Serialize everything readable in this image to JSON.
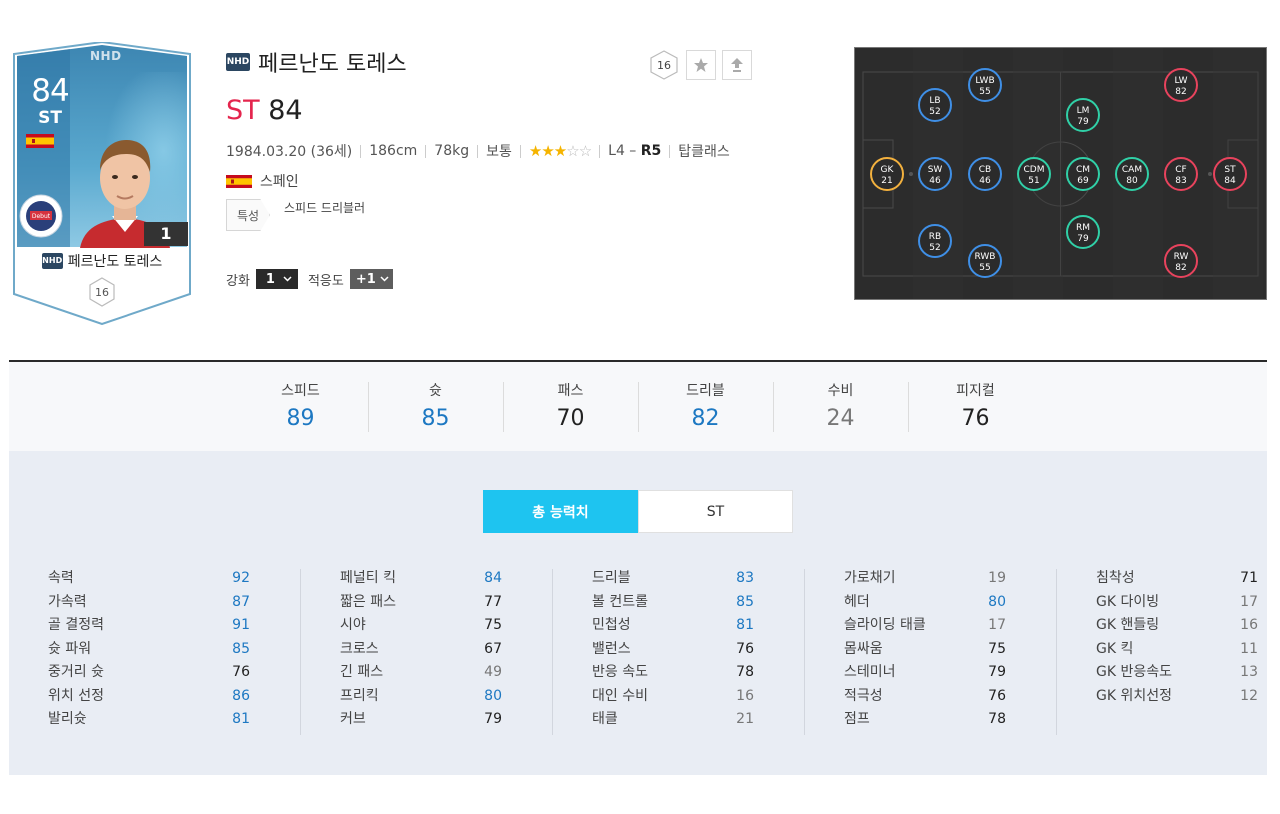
{
  "card": {
    "overall": "84",
    "position": "ST",
    "season": "NHD",
    "level": "1",
    "name": "페르난도 토레스",
    "hex_number": "16"
  },
  "player": {
    "season_badge": "NHD",
    "name": "페르난도 토레스",
    "position": "ST",
    "overall": "84",
    "birth": "1984.03.20 (36세)",
    "height": "186cm",
    "weight": "78kg",
    "body_type": "보통",
    "skill_stars": 3,
    "foot_left": "L4 –",
    "foot_right": "R5",
    "club_type": "탑클래스",
    "nation": "스페인",
    "trait_label": "특성",
    "trait": "스피드 드리블러",
    "enhance_label": "강화",
    "enhance_value": "1",
    "adapt_label": "적응도",
    "adapt_value": "+1"
  },
  "actions": {
    "hex_number": "16",
    "star_icon": "star-icon",
    "upgrade_icon": "upgrade-arrow-icon"
  },
  "pitch": {
    "positions": [
      {
        "pos": "GK",
        "val": "21",
        "kind": "gk"
      },
      {
        "pos": "SW",
        "val": "46",
        "kind": "def"
      },
      {
        "pos": "LB",
        "val": "52",
        "kind": "def"
      },
      {
        "pos": "RB",
        "val": "52",
        "kind": "def"
      },
      {
        "pos": "LWB",
        "val": "55",
        "kind": "def"
      },
      {
        "pos": "RWB",
        "val": "55",
        "kind": "def"
      },
      {
        "pos": "CB",
        "val": "46",
        "kind": "def"
      },
      {
        "pos": "CDM",
        "val": "51",
        "kind": "mid"
      },
      {
        "pos": "LM",
        "val": "79",
        "kind": "mid"
      },
      {
        "pos": "CM",
        "val": "69",
        "kind": "mid"
      },
      {
        "pos": "RM",
        "val": "79",
        "kind": "mid"
      },
      {
        "pos": "CAM",
        "val": "80",
        "kind": "mid"
      },
      {
        "pos": "LW",
        "val": "82",
        "kind": "fwd"
      },
      {
        "pos": "CF",
        "val": "83",
        "kind": "fwd"
      },
      {
        "pos": "RW",
        "val": "82",
        "kind": "fwd"
      },
      {
        "pos": "ST",
        "val": "84",
        "kind": "fwd"
      }
    ]
  },
  "summary": [
    {
      "label": "스피드",
      "value": "89",
      "tone": "blue"
    },
    {
      "label": "슛",
      "value": "85",
      "tone": "blue"
    },
    {
      "label": "패스",
      "value": "70",
      "tone": "dark"
    },
    {
      "label": "드리블",
      "value": "82",
      "tone": "blue"
    },
    {
      "label": "수비",
      "value": "24",
      "tone": "gray"
    },
    {
      "label": "피지컬",
      "value": "76",
      "tone": "dark"
    }
  ],
  "tabs": {
    "total": "총 능력치",
    "position": "ST"
  },
  "attributes": [
    [
      {
        "name": "속력",
        "value": "92",
        "tone": "blue"
      },
      {
        "name": "가속력",
        "value": "87",
        "tone": "blue"
      },
      {
        "name": "골 결정력",
        "value": "91",
        "tone": "blue"
      },
      {
        "name": "슛 파워",
        "value": "85",
        "tone": "blue"
      },
      {
        "name": "중거리 슛",
        "value": "76",
        "tone": "dark"
      },
      {
        "name": "위치 선정",
        "value": "86",
        "tone": "blue"
      },
      {
        "name": "발리슛",
        "value": "81",
        "tone": "blue"
      }
    ],
    [
      {
        "name": "페널티 킥",
        "value": "84",
        "tone": "blue"
      },
      {
        "name": "짧은 패스",
        "value": "77",
        "tone": "dark"
      },
      {
        "name": "시야",
        "value": "75",
        "tone": "dark"
      },
      {
        "name": "크로스",
        "value": "67",
        "tone": "dark"
      },
      {
        "name": "긴 패스",
        "value": "49",
        "tone": "gray"
      },
      {
        "name": "프리킥",
        "value": "80",
        "tone": "blue"
      },
      {
        "name": "커브",
        "value": "79",
        "tone": "dark"
      }
    ],
    [
      {
        "name": "드리블",
        "value": "83",
        "tone": "blue"
      },
      {
        "name": "볼 컨트롤",
        "value": "85",
        "tone": "blue"
      },
      {
        "name": "민첩성",
        "value": "81",
        "tone": "blue"
      },
      {
        "name": "밸런스",
        "value": "76",
        "tone": "dark"
      },
      {
        "name": "반응 속도",
        "value": "78",
        "tone": "dark"
      },
      {
        "name": "대인 수비",
        "value": "16",
        "tone": "gray"
      },
      {
        "name": "태클",
        "value": "21",
        "tone": "gray"
      }
    ],
    [
      {
        "name": "가로채기",
        "value": "19",
        "tone": "gray"
      },
      {
        "name": "헤더",
        "value": "80",
        "tone": "blue"
      },
      {
        "name": "슬라이딩 태클",
        "value": "17",
        "tone": "gray"
      },
      {
        "name": "몸싸움",
        "value": "75",
        "tone": "dark"
      },
      {
        "name": "스테미너",
        "value": "79",
        "tone": "dark"
      },
      {
        "name": "적극성",
        "value": "76",
        "tone": "dark"
      },
      {
        "name": "점프",
        "value": "78",
        "tone": "dark"
      }
    ],
    [
      {
        "name": "침착성",
        "value": "71",
        "tone": "dark"
      },
      {
        "name": "GK 다이빙",
        "value": "17",
        "tone": "gray"
      },
      {
        "name": "GK 핸들링",
        "value": "16",
        "tone": "gray"
      },
      {
        "name": "GK 킥",
        "value": "11",
        "tone": "gray"
      },
      {
        "name": "GK 반응속도",
        "value": "13",
        "tone": "gray"
      },
      {
        "name": "GK 위치선정",
        "value": "12",
        "tone": "gray"
      }
    ]
  ],
  "colors": {
    "accent": "#1ec4f0",
    "pos_red": "#e4254d",
    "stat_blue": "#1d78c2",
    "def": "#3f8fe6",
    "mid": "#30d0a7",
    "fwd": "#e8435d",
    "gk": "#f3b13e"
  }
}
